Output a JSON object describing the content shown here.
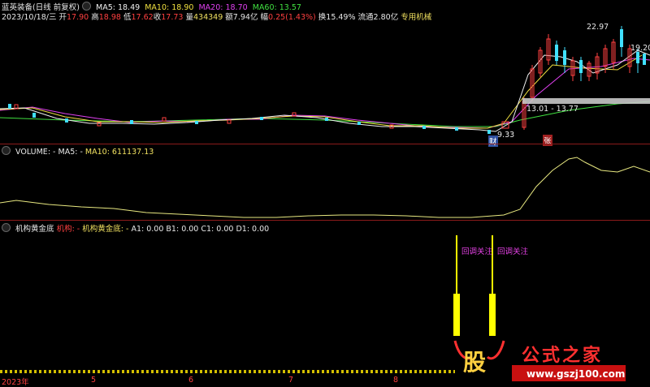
{
  "header": {
    "stock_name": "蓝英装备(日线 前复权)",
    "ma5_label": "MA5: 18.49",
    "ma10_label": "MA10: 18.90",
    "ma20_label": "MA20: 18.70",
    "ma60_label": "MA60: 13.57",
    "date": "2023/10/18/三",
    "open_label": "开",
    "open_value": "17.90",
    "high_label": "高",
    "high_value": "18.98",
    "low_label": "低",
    "low_value": "17.62",
    "close_label": "收",
    "close_value": "17.73",
    "volume_label": "量",
    "volume_value": "434349",
    "amount_label": "额",
    "amount_value": "7.94亿",
    "change_label": "幅",
    "change_value": "0.25(1.43%)",
    "turnover": "换15.49%",
    "float": "流通2.80亿",
    "tag": "专用机械"
  },
  "price_annotations": {
    "high_peak": "22.97",
    "right_price": "19.20",
    "box_range": "13.01 - 13.77",
    "low_mark": "9.33",
    "cai_badge": "财",
    "zhang_badge": "张"
  },
  "volume_panel": {
    "title": "VOLUME: -",
    "ma5": "MA5: -",
    "ma10": "MA10: 611137.13"
  },
  "indicator_panel": {
    "name": "机构黄金底",
    "sub1": "机构: -",
    "sub2": "机构黄金底: -",
    "a1": "A1: 0.00",
    "b1": "B1: 0.00",
    "c1": "C1: 0.00",
    "d1": "D1: 0.00",
    "signal1": "回调关注",
    "signal2": "回调关注"
  },
  "time_axis": {
    "labels": [
      "2023年",
      "5",
      "6",
      "7",
      "8"
    ]
  },
  "watermark": {
    "logo_char": "股",
    "site_name": "公式之家",
    "url": "www.gszj100.com"
  },
  "colors": {
    "background": "#000000",
    "up": "#ff4040",
    "down": "#40e0ff",
    "ma5": "#f0f0f0",
    "ma10": "#f0e040",
    "ma20": "#e040f0",
    "ma60": "#40e040",
    "divider": "#8b1a1a"
  }
}
